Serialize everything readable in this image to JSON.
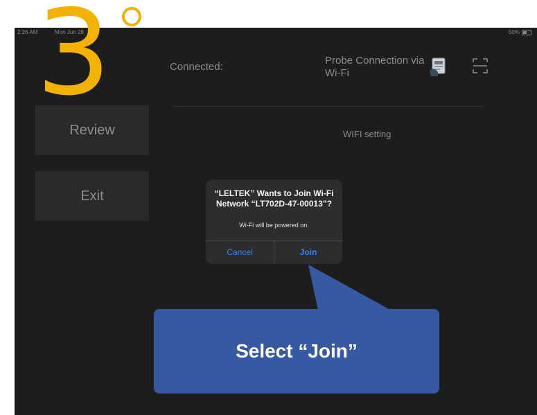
{
  "overlay": {
    "step_number": "3",
    "callout_text": "Select “Join”",
    "accent_color": "#f3b100",
    "callout_color": "#3659a2"
  },
  "status_bar": {
    "time": "2:26 AM",
    "date": "Mon Jun 28",
    "battery": "50%"
  },
  "sidebar": {
    "items": [
      {
        "label": "Review"
      },
      {
        "label": "Exit"
      }
    ]
  },
  "header": {
    "connected_label": "Connected:",
    "probe_connection": "Probe Connection via Wi-Fi",
    "probe_icon": "probe-device-icon",
    "scan_icon": "scan-frame-icon"
  },
  "main": {
    "wifi_setting": "WIFI setting"
  },
  "dialog": {
    "title": "“LELTEK” Wants to Join Wi-Fi Network “LT702D-47-00013”?",
    "message": "Wi-Fi will be powered on.",
    "cancel_label": "Cancel",
    "join_label": "Join",
    "button_color": "#3b82f6"
  }
}
